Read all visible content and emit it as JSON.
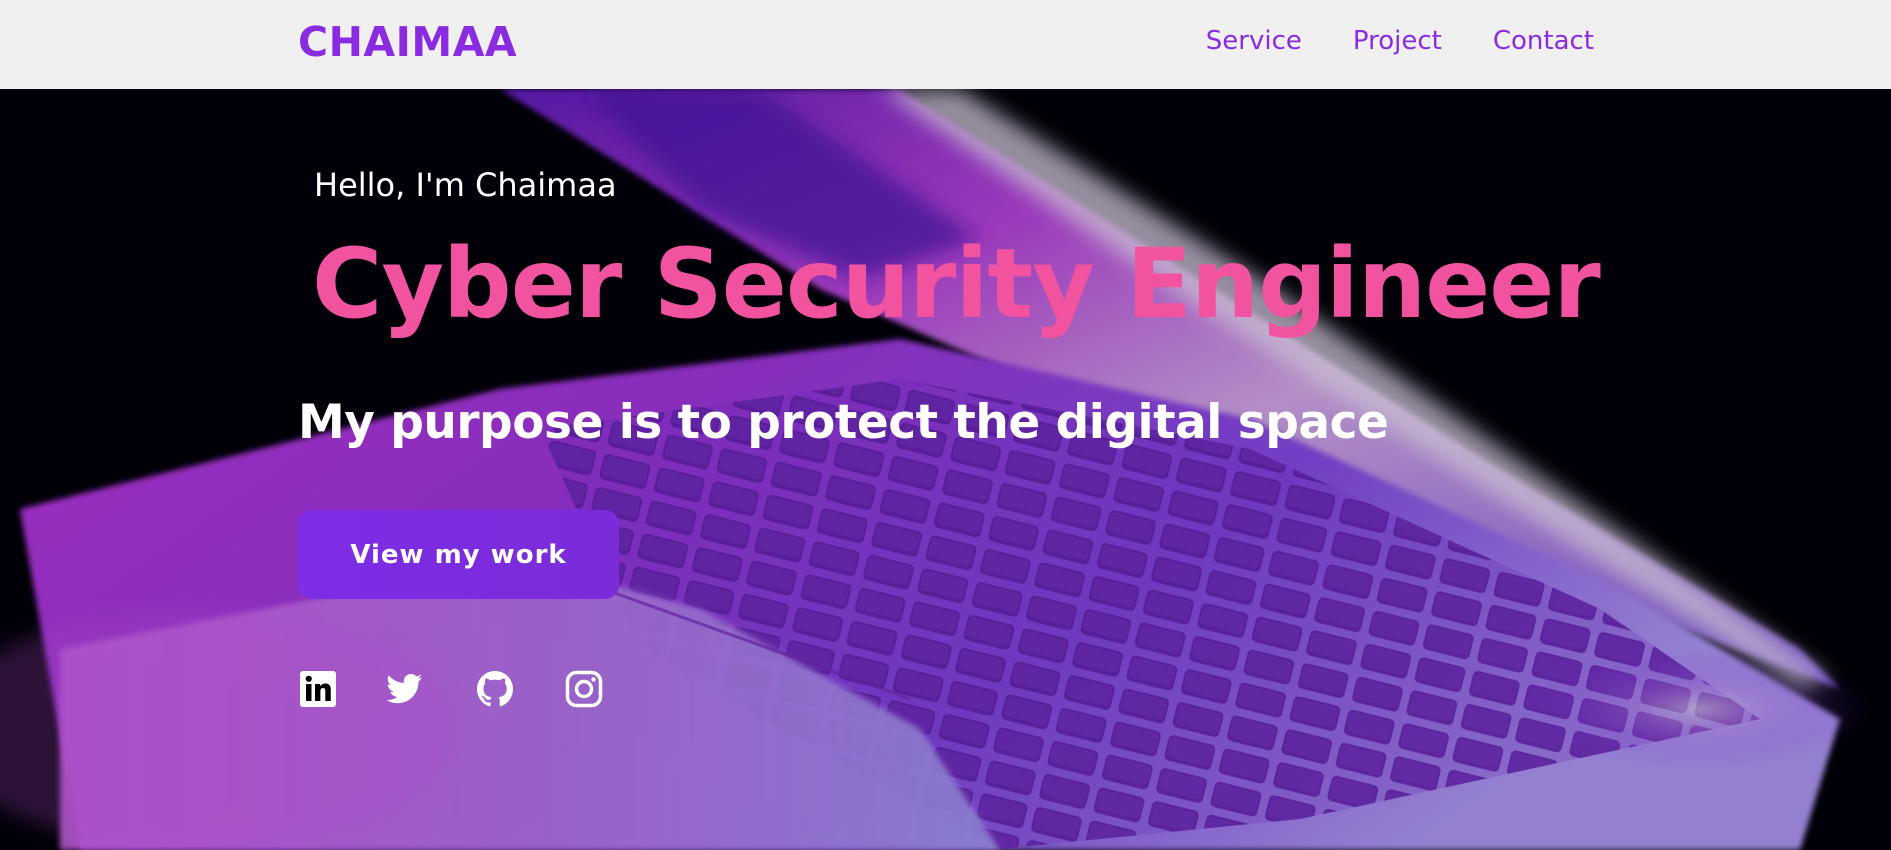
{
  "brand": {
    "name": "CHAIMAA",
    "color": "#8a2be2"
  },
  "nav": {
    "items": [
      {
        "label": "Service"
      },
      {
        "label": "Project"
      },
      {
        "label": "Contact"
      }
    ]
  },
  "hero": {
    "greeting": "Hello, I'm Chaimaa",
    "title": "Cyber Security Engineer",
    "title_color": "#f2539f",
    "tagline": "My purpose is to protect the digital space",
    "cta_label": "View my work",
    "cta_color": "#7d2ee6",
    "background_image": "laptop-keyboard-purple-glow"
  },
  "socials": [
    {
      "icon": "linkedin-icon"
    },
    {
      "icon": "twitter-icon"
    },
    {
      "icon": "github-icon"
    },
    {
      "icon": "instagram-icon"
    }
  ]
}
